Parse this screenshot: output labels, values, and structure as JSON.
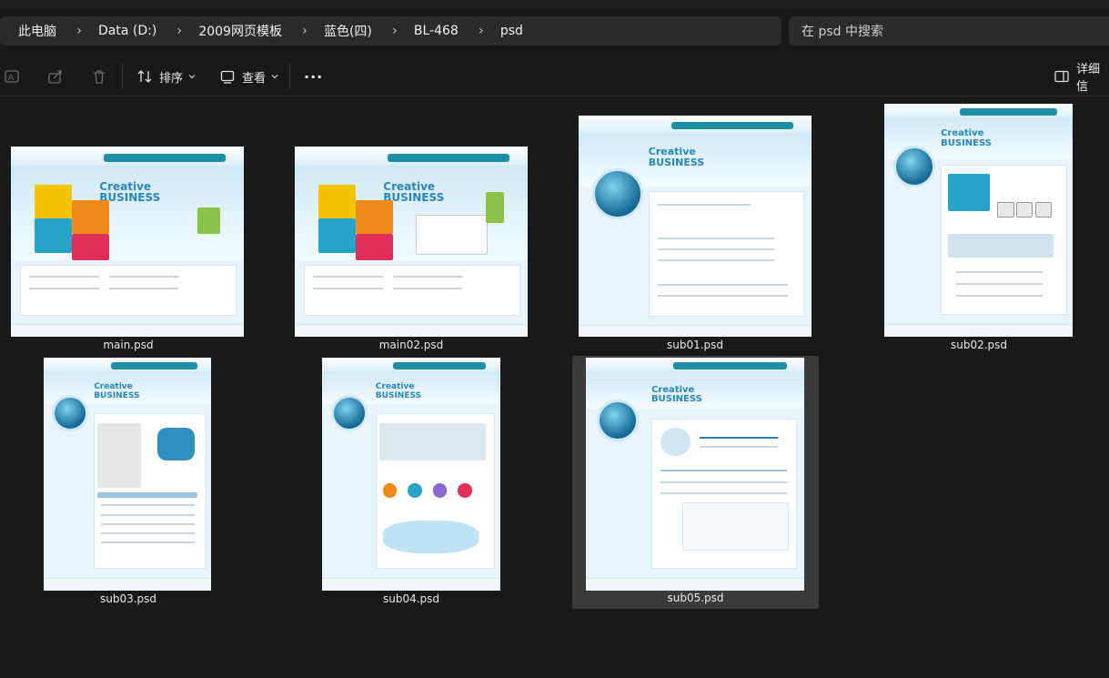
{
  "breadcrumb": {
    "items": [
      "此电脑",
      "Data (D:)",
      "2009网页模板",
      "蓝色(四)",
      "BL-468",
      "psd"
    ]
  },
  "search": {
    "placeholder": "在 psd 中搜索"
  },
  "toolbar": {
    "sort_label": "排序",
    "view_label": "查看",
    "more_label": "···",
    "details_label": "详细信"
  },
  "files": [
    {
      "name": "main.psd",
      "title": "Creative\nBUSINESS",
      "type": "main"
    },
    {
      "name": "main02.psd",
      "title": "Creative\nBUSINESS",
      "type": "main"
    },
    {
      "name": "sub01.psd",
      "title": "Creative\nBUSINESS",
      "type": "sub"
    },
    {
      "name": "sub02.psd",
      "title": "Creative\nBUSINESS",
      "type": "sub"
    },
    {
      "name": "sub03.psd",
      "title": "Creative\nBUSINESS",
      "type": "sub"
    },
    {
      "name": "sub04.psd",
      "title": "Creative\nBUSINESS",
      "type": "sub"
    },
    {
      "name": "sub05.psd",
      "title": "Creative\nBUSINESS",
      "type": "sub",
      "selected": true
    }
  ],
  "colors": {
    "background": "#191919",
    "bar": "#2b2b2b",
    "selection": "#3a3a3a",
    "thumb_accent": "#1f8fa5",
    "thumb_title": "#2a86b8"
  },
  "icons": {
    "ai": "ai-icon",
    "share": "share-icon",
    "delete": "trash-icon",
    "sort": "sort-icon",
    "view": "view-icon",
    "details": "details-pane-icon"
  }
}
